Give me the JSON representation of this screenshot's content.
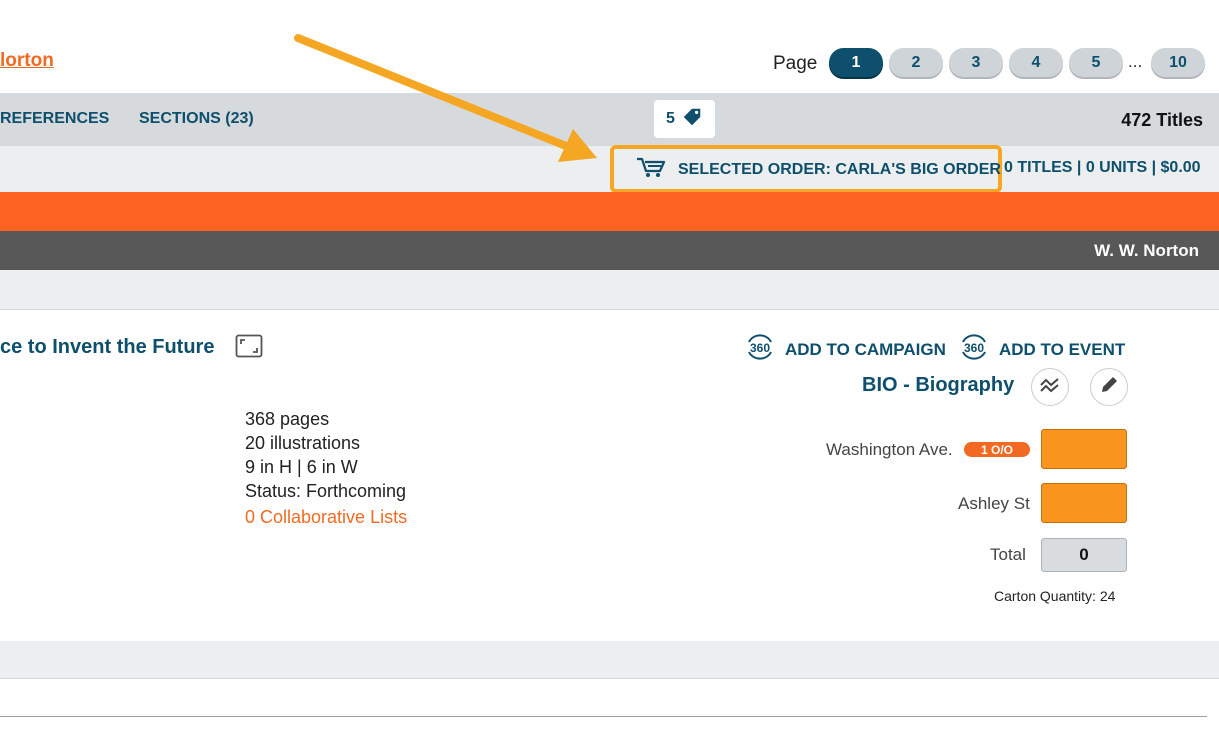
{
  "header": {
    "publisher_link": "lorton",
    "page_label": "Page",
    "pages": [
      "1",
      "2",
      "3",
      "4",
      "5"
    ],
    "ellipsis": "...",
    "last_page": "10",
    "active_page": "1"
  },
  "nav": {
    "items": [
      "REFERENCES",
      "SECTIONS (23)"
    ],
    "tag_count": "5",
    "titles": "472 Titles"
  },
  "order": {
    "label": "SELECTED ORDER: CARLA'S BIG ORDER",
    "summary": "0 TITLES | 0 UNITS | $0.00",
    "highlight_color": "#f5a623"
  },
  "publisher_bar": {
    "publisher": "W. W. Norton"
  },
  "book": {
    "title_fragment": "ce to Invent the Future",
    "details": [
      "368 pages",
      "20 illustrations",
      "9 in H | 6 in W",
      "Status: Forthcoming"
    ],
    "collaborative_lists": "0 Collaborative Lists"
  },
  "actions": {
    "add_to_campaign": "ADD TO CAMPAIGN",
    "add_to_event": "ADD TO EVENT",
    "bisac": "BIO - Biography"
  },
  "ordering": {
    "locations": [
      {
        "name": "Washington Ave.",
        "badge": "1 O/O",
        "qty": ""
      },
      {
        "name": "Ashley St",
        "badge": "",
        "qty": ""
      }
    ],
    "total_label": "Total",
    "total_value": "0",
    "carton": "Carton Quantity: 24"
  },
  "colors": {
    "brand_blue": "#0d4f6c",
    "orange": "#fc6320",
    "qty_fill": "#f9941e"
  }
}
